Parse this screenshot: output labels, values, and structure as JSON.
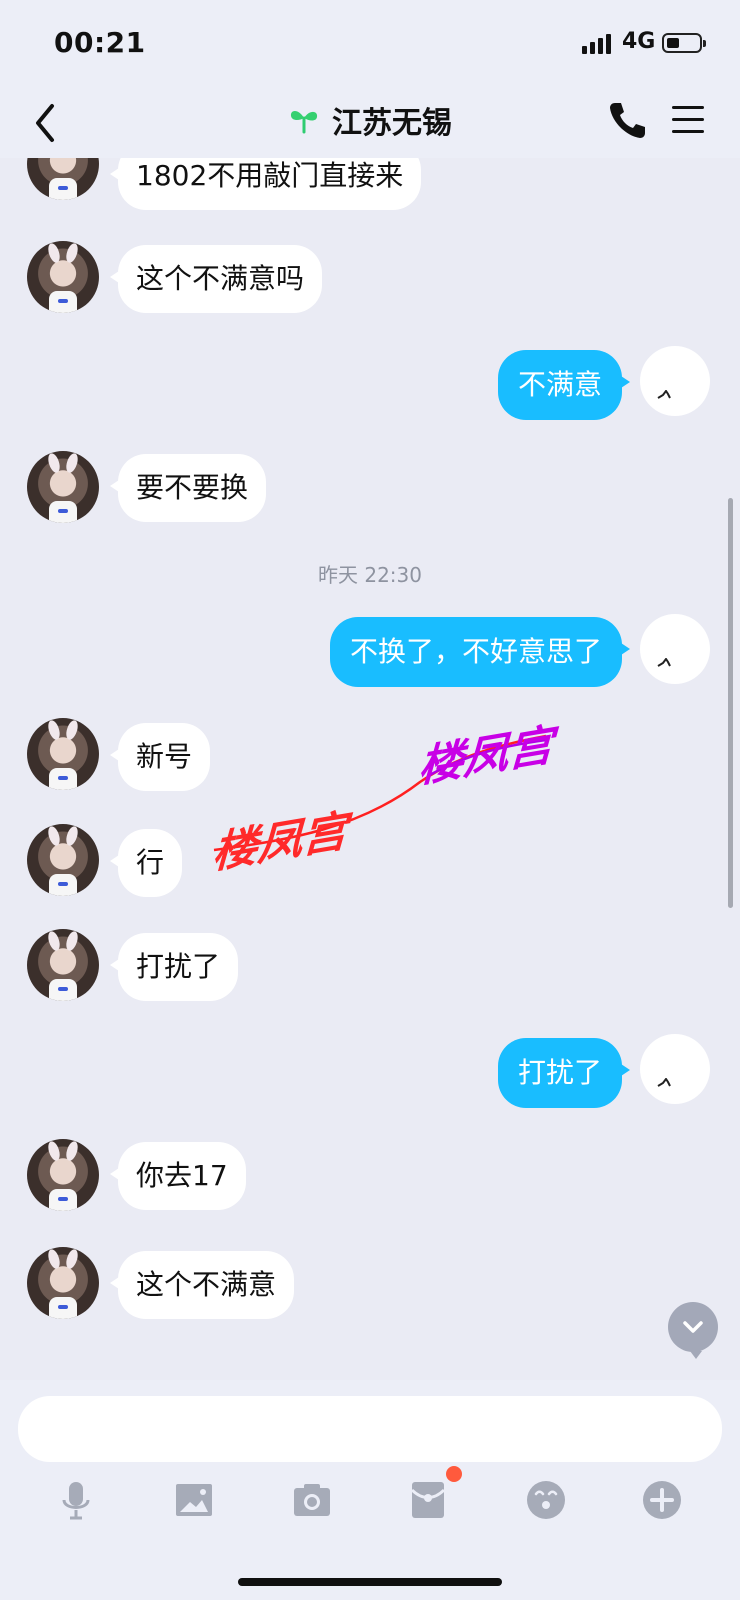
{
  "status_bar": {
    "time": "00:21",
    "network": "4G"
  },
  "nav": {
    "title": "江苏无锡"
  },
  "messages": [
    {
      "side": "left",
      "text": "1802不用敲门直接来"
    },
    {
      "side": "left",
      "text": "这个不满意吗"
    },
    {
      "side": "right",
      "text": "不满意"
    },
    {
      "side": "left",
      "text": "要不要换"
    },
    {
      "side": "timestamp",
      "text": "昨天 22:30"
    },
    {
      "side": "right",
      "text": "不换了，不好意思了"
    },
    {
      "side": "left",
      "text": "新号"
    },
    {
      "side": "left",
      "text": "行"
    },
    {
      "side": "left",
      "text": "打扰了"
    },
    {
      "side": "right",
      "text": "打扰了"
    },
    {
      "side": "left",
      "text": "你去17"
    },
    {
      "side": "left",
      "text": "这个不满意"
    }
  ],
  "watermarks": {
    "left": "楼凤宫",
    "right": "楼凤宫"
  },
  "toolbar": {
    "icons": [
      "microphone-icon",
      "image-icon",
      "camera-icon",
      "red-packet-icon",
      "emoji-icon",
      "plus-icon"
    ]
  },
  "colors": {
    "accent": "#19bdff",
    "background": "#eaebf4",
    "notification": "#ff5a3d"
  }
}
